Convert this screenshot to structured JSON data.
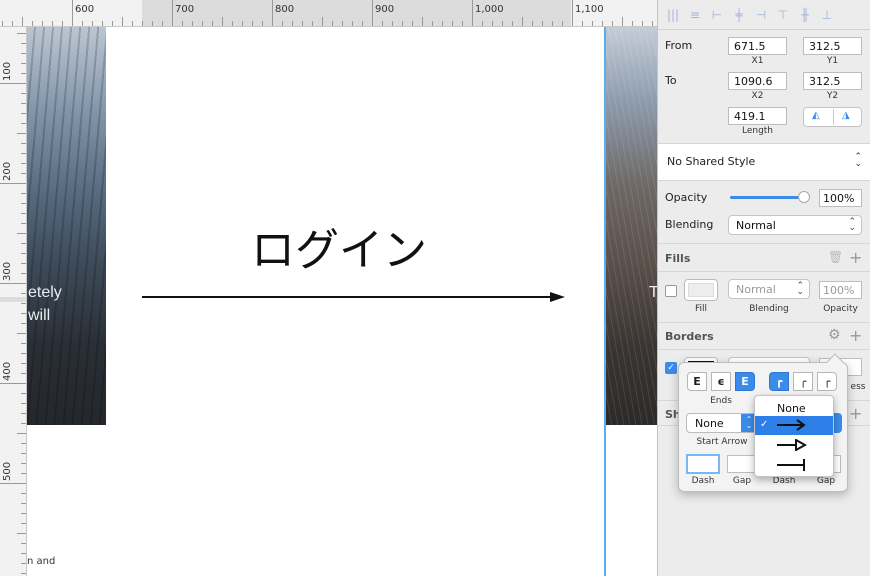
{
  "ruler": {
    "h_labels": [
      "600",
      "700",
      "800",
      "900",
      "1,000",
      "1,100"
    ],
    "v_labels": [
      "100",
      "200",
      "300",
      "400",
      "500"
    ]
  },
  "canvas": {
    "heading": "ログイン",
    "photo_left_text": [
      "etely",
      "will"
    ],
    "photo_right_text": "T",
    "bottom_text": "n and",
    "artboard_guide_color": "#5aaef0"
  },
  "inspector": {
    "align_icons": [
      "distribute-h-icon",
      "distribute-v-icon",
      "align-left-icon",
      "align-center-h-icon",
      "align-right-icon",
      "align-top-icon",
      "align-middle-v-icon",
      "align-bottom-icon"
    ],
    "from_label": "From",
    "to_label": "To",
    "x1": "671.5",
    "x1_label": "X1",
    "y1": "312.5",
    "y1_label": "Y1",
    "x2": "1090.6",
    "x2_label": "X2",
    "y2": "312.5",
    "y2_label": "Y2",
    "length": "419.1",
    "length_label": "Length",
    "shared_style": "No Shared Style",
    "opacity_label": "Opacity",
    "opacity_value": "100%",
    "opacity_fraction": 1.0,
    "blending_label": "Blending",
    "blending_value": "Normal",
    "fills": {
      "title": "Fills",
      "blend_value": "Normal",
      "opacity_value": "100%",
      "fill_label": "Fill",
      "blending_label": "Blending",
      "opacity_label": "Opacity"
    },
    "borders": {
      "title": "Borders",
      "thickness_label_partial": "ess"
    },
    "shadows_partial": "Sh",
    "accent_color": "#3b8bea"
  },
  "popover": {
    "ends_label": "Ends",
    "start_arrow_label": "Start Arrow",
    "start_arrow_value": "None",
    "dash_label": "Dash",
    "gap_label": "Gap",
    "dash2_label": "Dash",
    "gap2_label": "Gap",
    "menu": {
      "items": [
        "None",
        "arrow-open",
        "arrow-filled",
        "arrow-line"
      ],
      "none_label": "None",
      "selected_index": 1,
      "checkmark": "✓"
    }
  }
}
